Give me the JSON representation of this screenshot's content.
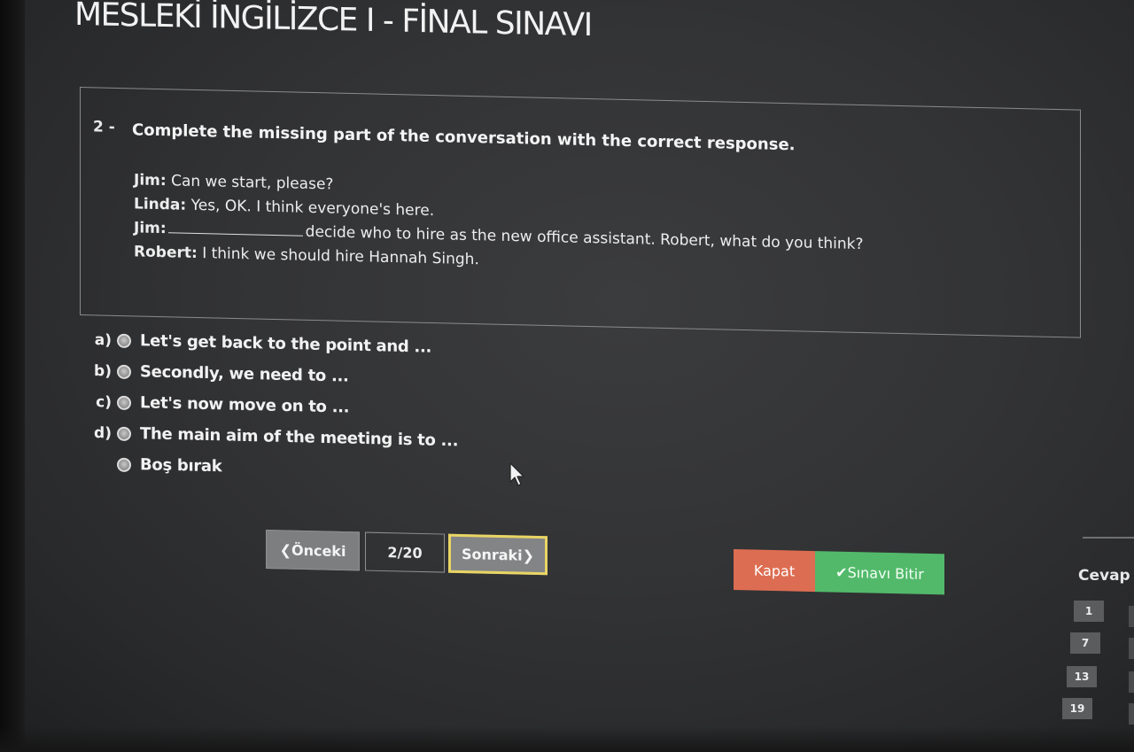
{
  "exam": {
    "title": "MESLEKİ İNGİLİZCE I - FİNAL SINAVI"
  },
  "question": {
    "number": "2 -",
    "prompt": "Complete the missing part of the conversation with the correct response.",
    "dialogue": [
      {
        "speaker": "Jim:",
        "before": "Can we start, please?",
        "has_blank": false,
        "after": ""
      },
      {
        "speaker": "Linda:",
        "before": "Yes, OK. I think everyone's here.",
        "has_blank": false,
        "after": ""
      },
      {
        "speaker": "Jim:",
        "before": "",
        "has_blank": true,
        "after": "decide who to hire as the new office assistant. Robert, what do you think?"
      },
      {
        "speaker": "Robert:",
        "before": "I think we should hire Hannah Singh.",
        "has_blank": false,
        "after": ""
      }
    ]
  },
  "options": [
    {
      "letter": "a)",
      "text": "Let's get back to the point and ..."
    },
    {
      "letter": "b)",
      "text": "Secondly, we need to ..."
    },
    {
      "letter": "c)",
      "text": "Let's now move on to ..."
    },
    {
      "letter": "d)",
      "text": "The main aim of the meeting is to ..."
    },
    {
      "letter": "",
      "text": "Boş bırak"
    }
  ],
  "navigation": {
    "prev_label": "❮Önceki",
    "page": "2/20",
    "next_label": "Sonraki❯"
  },
  "actions": {
    "close_label": "Kapat",
    "finish_label": "✔Sınavı Bitir"
  },
  "answer_panel": {
    "label": "Cevap L",
    "question_numbers": [
      "1",
      "7",
      "13",
      "19"
    ]
  },
  "colors": {
    "close": "#dd6d52",
    "finish": "#52b96a",
    "next_border": "#e9d564"
  }
}
